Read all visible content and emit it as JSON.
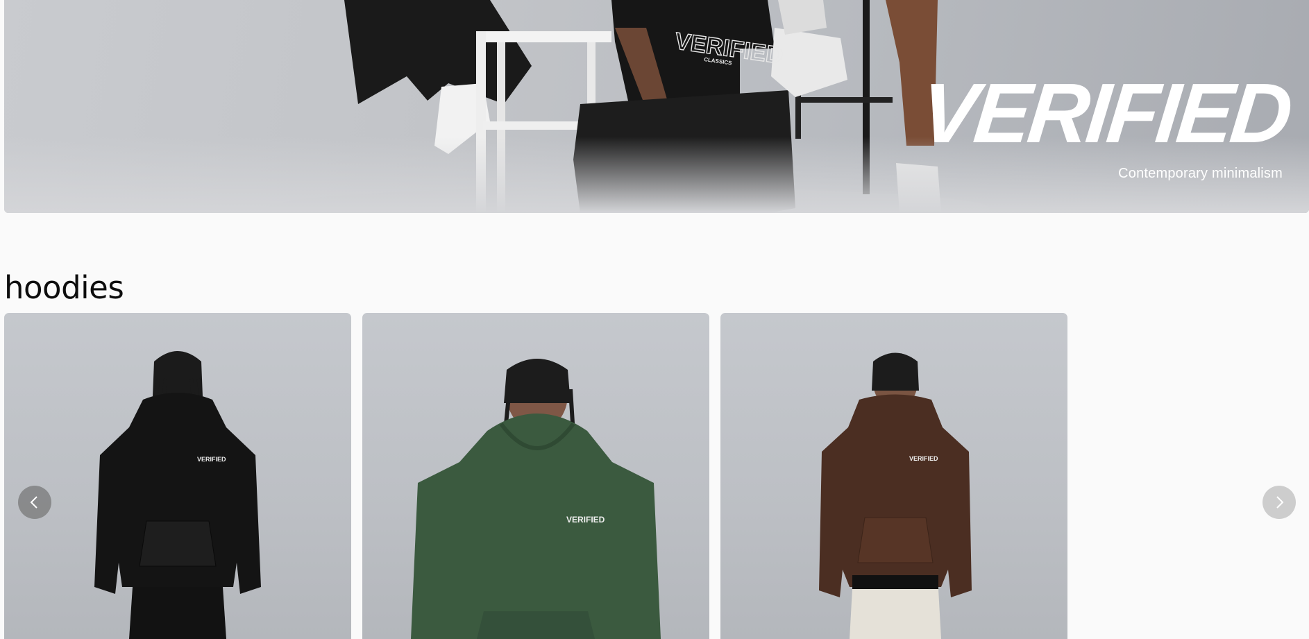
{
  "hero": {
    "title": "VERIFIED",
    "subtitle": "Contemporary minimalism",
    "tee_print": "VERIFIED",
    "tee_print_sub": "CLASSICS"
  },
  "section": {
    "title": "hoodies"
  },
  "products": [
    {
      "color_name": "black",
      "hoodie_color": "#141414",
      "print": "VERIFIED"
    },
    {
      "color_name": "green",
      "hoodie_color": "#3b5a3f",
      "print": "VERIFIED"
    },
    {
      "color_name": "brown",
      "hoodie_color": "#4b2e22",
      "print": "VERIFIED"
    }
  ],
  "carousel": {
    "prev_icon": "chevron-left-icon",
    "next_icon": "chevron-right-icon"
  }
}
